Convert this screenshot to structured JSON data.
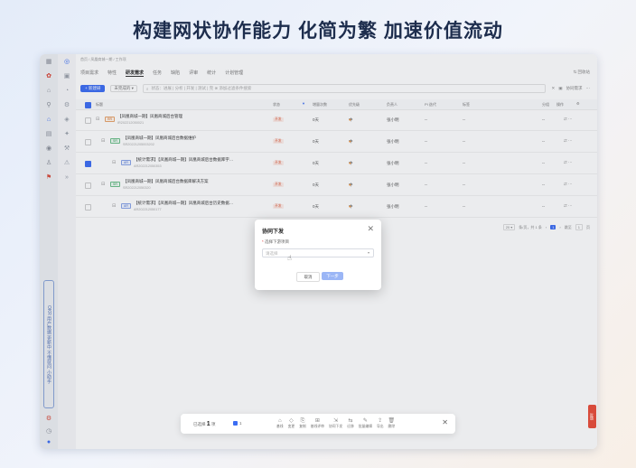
{
  "headline": "构建网状协作能力 化简为繁 加速价值流动",
  "breadcrumb": "首页 / 凤凰商城一期 / 工作项",
  "tabs": [
    "项目需求",
    "特性",
    "研发需求",
    "任务",
    "缺陷",
    "评审",
    "统计",
    "计划管理"
  ],
  "tabs_right": "⇅ 回收站",
  "toolbar": {
    "new_btn": "+ 新建研",
    "filter": "未完成的 ▾",
    "search_placeholder": "状态：进展 | 分析 | 开发 | 测试 | 完 ⊗  添加过滤条件搜索",
    "right_checkbox": "协同需求"
  },
  "columns": [
    "标题",
    "状态",
    "增量次数",
    "优先级",
    "负责人",
    "PI 迭代",
    "标签",
    "分组",
    "操作"
  ],
  "rows": [
    {
      "title": "【凤凰商城一期】凤凰商城后台管理",
      "id": "IR202212050021",
      "tag": "RR",
      "status": "开发",
      "count": "0天",
      "prio": "中",
      "owner": "张小明",
      "pi": "--",
      "label": "--",
      "checked": false
    },
    {
      "title": "【凤凰商城一期】凤凰商城后台数据维护",
      "id": "SR20221205003202",
      "tag": "SR",
      "status": "开发",
      "count": "0天",
      "prio": "中",
      "owner": "张小明",
      "pi": "--",
      "label": "--",
      "checked": false
    },
    {
      "title": "【统计需求】【凤凰商城一期】凤凰商城后台数据库字…",
      "id": "AR202212050353",
      "tag": "AR",
      "status": "开发",
      "count": "0天",
      "prio": "中",
      "owner": "张小明",
      "pi": "--",
      "label": "--",
      "checked": true
    },
    {
      "title": "【凤凰商城一期】凤凰商城后台数据库解决方案",
      "id": "SR202212050320",
      "tag": "SR",
      "status": "开发",
      "count": "0天",
      "prio": "中",
      "owner": "张小明",
      "pi": "--",
      "label": "--",
      "checked": false
    },
    {
      "title": "【统计需求】【凤凰商城一期】凤凰商城后台历史数据…",
      "id": "AR202212050177",
      "tag": "AR",
      "status": "开发",
      "count": "0天",
      "prio": "中",
      "owner": "张小明",
      "pi": "--",
      "label": "--",
      "checked": false
    }
  ],
  "pager": {
    "per_page": "20 ▾",
    "summary": "条/页，共 1 条",
    "page": "1",
    "goto": "跳至",
    "goto_val": "1",
    "unit": "页"
  },
  "modal": {
    "title": "协同下发",
    "close": "✕",
    "label": "选择下游项目",
    "placeholder": "请选择",
    "cancel": "取消",
    "next": "下一步"
  },
  "bulk": {
    "selected_prefix": "已选择",
    "selected_count": "1",
    "selected_suffix": "项",
    "chip_count": "1",
    "actions": [
      {
        "icon": "⌂",
        "label": "基线"
      },
      {
        "icon": "◇",
        "label": "变更"
      },
      {
        "icon": "⎘",
        "label": "复制"
      },
      {
        "icon": "⊞",
        "label": "基线评审"
      },
      {
        "icon": "⇲",
        "label": "协同下发"
      },
      {
        "icon": "⇆",
        "label": "迁移"
      },
      {
        "icon": "✎",
        "label": "批量编辑"
      },
      {
        "icon": "⇪",
        "label": "导出"
      },
      {
        "icon": "🗑",
        "label": "删除"
      }
    ],
    "close": "✕"
  },
  "vertical_tab": "OKR 用户数据 更新中 不懂就问 小助手",
  "red_tab": "反馈"
}
